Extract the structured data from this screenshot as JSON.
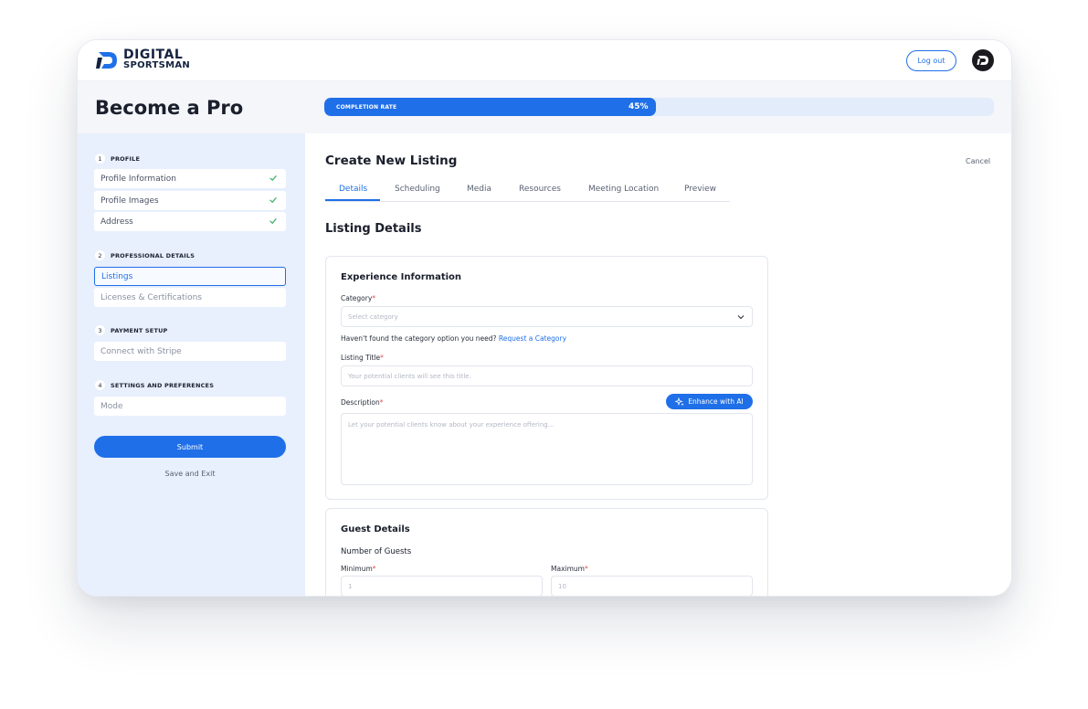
{
  "brand": {
    "line1": "DIGITAL",
    "line2": "SPORTSMAN"
  },
  "header": {
    "logout_label": "Log out"
  },
  "page": {
    "title": "Become a Pro"
  },
  "progress": {
    "label": "COMPLETION RATE",
    "value_text": "45%",
    "fraction": 0.45,
    "color": "#1f6fe8"
  },
  "sidebar": {
    "sections": [
      {
        "num": "1",
        "title": "PROFILE"
      },
      {
        "num": "2",
        "title": "PROFESSIONAL DETAILS"
      },
      {
        "num": "3",
        "title": "PAYMENT SETUP"
      },
      {
        "num": "4",
        "title": "SETTINGS AND PREFERENCES"
      }
    ],
    "items": {
      "profile_information": "Profile Information",
      "profile_images": "Profile Images",
      "address": "Address",
      "listings": "Listings",
      "licenses": "Licenses & Certifications",
      "stripe": "Connect with Stripe",
      "mode": "Mode"
    },
    "submit_label": "Submit",
    "save_exit_label": "Save and Exit"
  },
  "main": {
    "title": "Create New Listing",
    "cancel_label": "Cancel",
    "tabs": [
      "Details",
      "Scheduling",
      "Media",
      "Resources",
      "Meeting Location",
      "Preview"
    ],
    "active_tab": "Details",
    "section_title": "Listing Details"
  },
  "experience": {
    "title": "Experience Information",
    "category_label": "Category",
    "category_placeholder": "Select category",
    "hint_text": "Haven't found the category option you need?",
    "hint_link": "Request a Category",
    "listing_title_label": "Listing Title",
    "listing_title_placeholder": "Your potential clients will see this title.",
    "description_label": "Description",
    "ai_button_label": "Enhance with AI",
    "description_placeholder": "Let your potential clients know about your experience offering..."
  },
  "guests": {
    "title": "Guest Details",
    "subtitle": "Number of Guests",
    "min_label": "Minimum",
    "min_placeholder": "1",
    "max_label": "Maximum",
    "max_placeholder": "10"
  },
  "required_mark": "*"
}
